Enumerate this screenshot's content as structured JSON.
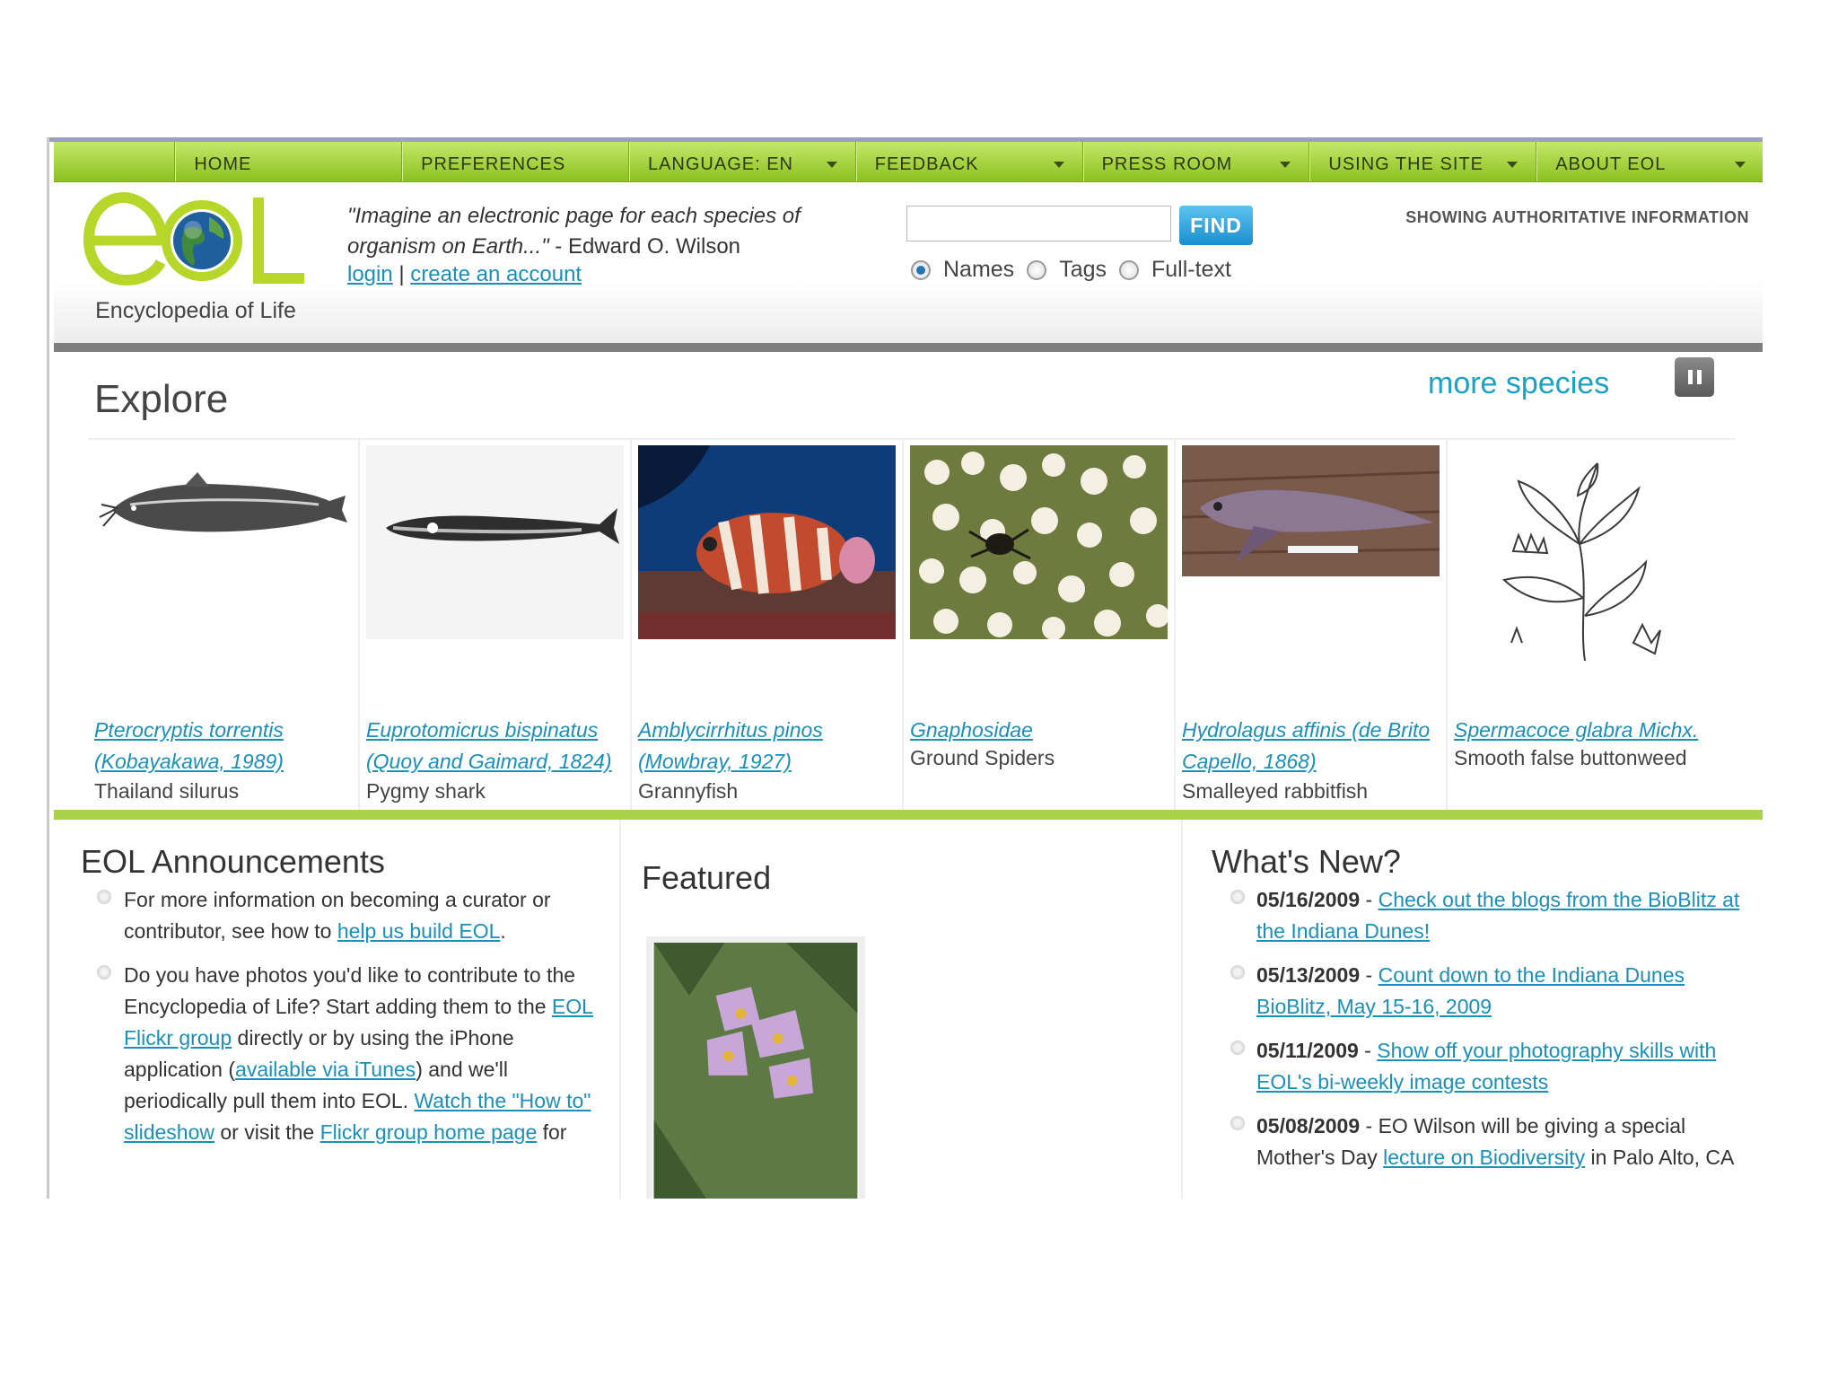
{
  "nav": {
    "items": [
      {
        "label": "HOME",
        "dropdown": false
      },
      {
        "label": "PREFERENCES",
        "dropdown": false
      },
      {
        "label": "LANGUAGE: EN",
        "dropdown": true
      },
      {
        "label": "FEEDBACK",
        "dropdown": true
      },
      {
        "label": "PRESS ROOM",
        "dropdown": true
      },
      {
        "label": "USING THE SITE",
        "dropdown": true
      },
      {
        "label": "ABOUT EOL",
        "dropdown": true
      }
    ]
  },
  "header": {
    "logo_tagline": "Encyclopedia of Life",
    "quote": "\"Imagine an electronic page for each species of organism on Earth...\"",
    "quote_author": " - Edward O. Wilson",
    "login": "login",
    "separator": "|",
    "create_account": "create an account",
    "search_value": "",
    "find_label": "FIND",
    "search_options": [
      {
        "label": "Names",
        "selected": true
      },
      {
        "label": "Tags",
        "selected": false
      },
      {
        "label": "Full-text",
        "selected": false
      }
    ],
    "showing": "SHOWING AUTHORITATIVE INFORMATION"
  },
  "explore": {
    "title": "Explore",
    "more_species": "more species",
    "species": [
      {
        "sci_line1": "Pterocryptis torrentis",
        "sci_line2": "(Kobayakawa, 1989)",
        "common": "Thailand silurus",
        "image": "catfish-illustration"
      },
      {
        "sci_line1": "Euprotomicrus bispinatus",
        "sci_line2": "(Quoy and Gaimard, 1824)",
        "common": "Pygmy shark",
        "image": "shark-illustration"
      },
      {
        "sci_line1": "Amblycirrhitus pinos",
        "sci_line2": "(Mowbray, 1927)",
        "common": "Grannyfish",
        "image": "reef-fish-photo"
      },
      {
        "sci_line1": "Gnaphosidae",
        "sci_line2": "",
        "common": "Ground Spiders",
        "image": "spider-on-flowers-photo"
      },
      {
        "sci_line1": "Hydrolagus affinis (de Brito",
        "sci_line2": "Capello, 1868)",
        "common": "Smalleyed rabbitfish",
        "image": "rabbitfish-photo"
      },
      {
        "sci_line1": "Spermacoce glabra Michx.",
        "sci_line2": "",
        "common": "Smooth false buttonweed",
        "image": "plant-illustration"
      }
    ]
  },
  "announcements": {
    "title": "EOL Announcements",
    "item1": {
      "text1": "For more information on becoming a curator or contributor, see how to ",
      "link1": "help us build EOL",
      "text2": "."
    },
    "item2": {
      "text1": "Do you have photos you'd like to contribute to the Encyclopedia of Life? Start adding them to the ",
      "link1": "EOL Flickr group",
      "text2": " directly or by using the iPhone application (",
      "link2": "available via iTunes",
      "text3": ") and we'll periodically pull them into EOL. ",
      "link3": "Watch the \"How to\" slideshow",
      "text4": " or visit the ",
      "link4": "Flickr group home page",
      "text5": " for"
    }
  },
  "featured": {
    "title": "Featured",
    "image": "purple-flower-photo"
  },
  "whats_new": {
    "title": "What's New?",
    "items": [
      {
        "date": "05/16/2009",
        "sep": " - ",
        "link": "Check out the blogs from the BioBlitz at the Indiana Dunes!",
        "text": ""
      },
      {
        "date": "05/13/2009",
        "sep": " - ",
        "link": "Count down to the Indiana Dunes BioBlitz, May 15-16, 2009",
        "text": ""
      },
      {
        "date": "05/11/2009",
        "sep": " - ",
        "link": "Show off your photography skills with EOL's bi-weekly image contests",
        "text": ""
      },
      {
        "date": "05/08/2009",
        "sep": " - ",
        "link": "lecture on Biodiversity",
        "text_before": "EO Wilson will be giving a special Mother's Day ",
        "text_after": " in Palo Alto, CA"
      }
    ]
  },
  "colors": {
    "nav_green": "#8bc11f",
    "accent_green": "#a8d34a",
    "link_blue": "#1a8fb8",
    "find_blue": "#1a8fcf"
  }
}
